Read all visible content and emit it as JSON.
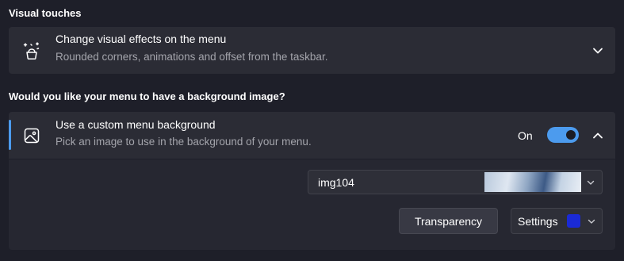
{
  "visual_touches": {
    "section_title": "Visual touches",
    "effects_card": {
      "icon": "sparkle-effects-icon",
      "title": "Change visual effects on the menu",
      "description": "Rounded corners, animations and offset from the taskbar."
    }
  },
  "background_section": {
    "section_title": "Would you like your menu to have a background image?",
    "custom_bg_card": {
      "icon": "image-icon",
      "title": "Use a custom menu background",
      "description": "Pick an image to use in the background of your menu.",
      "toggle_state_label": "On",
      "toggle_on": true
    },
    "image_select": {
      "value": "img104"
    },
    "transparency_button": "Transparency",
    "settings_select": {
      "label": "Settings",
      "color": "#1a2ad6"
    }
  },
  "colors": {
    "accent": "#4c9bee",
    "background": "#1e1f29",
    "card": "#2b2c35"
  }
}
